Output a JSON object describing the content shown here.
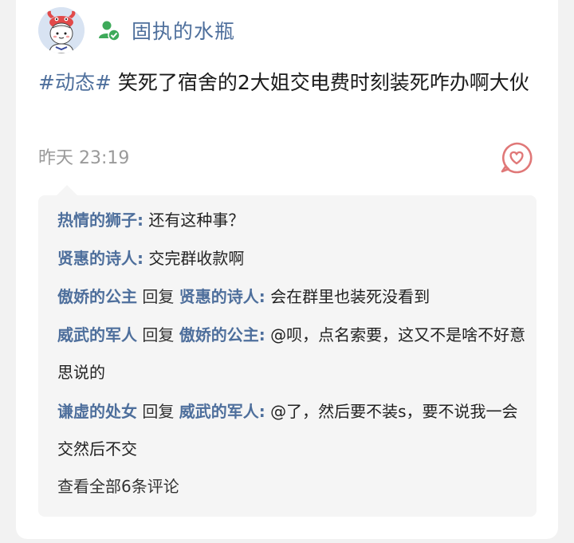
{
  "user": {
    "name": "固执的水瓶",
    "avatar_icon": "crab-avatar",
    "verified_icon": "user-check-icon"
  },
  "post": {
    "tag": "#动态#",
    "text": " 笑死了宿舍的2大姐交电费时刻装死咋办啊大伙",
    "time": "昨天 23:19"
  },
  "like_icon": "heart-chat-icon",
  "comments": [
    {
      "author": "热情的狮子",
      "sep": ":",
      "text": " 还有这种事？"
    },
    {
      "author": "贤惠的诗人",
      "sep": ":",
      "text": " 交完群收款啊"
    },
    {
      "author": "傲娇的公主",
      "reply_word": " 回复 ",
      "reply_to": "贤惠的诗人",
      "sep": ":",
      "text": " 会在群里也装死没看到"
    },
    {
      "author": "威武的军人",
      "reply_word": " 回复 ",
      "reply_to": "傲娇的公主",
      "sep": ":",
      "text": " @呗，点名索要，这又不是啥不好意思说的"
    },
    {
      "author": "谦虚的处女",
      "reply_word": " 回复 ",
      "reply_to": "威武的军人",
      "sep": ":",
      "text": " @了，然后要不装s，要不说我一会交然后不交"
    }
  ],
  "view_all": "查看全部6条评论",
  "colors": {
    "link": "#4e6f9c",
    "verified": "#3eaa5a",
    "like": "#e07878",
    "comment_bg": "#f5f5f5"
  }
}
